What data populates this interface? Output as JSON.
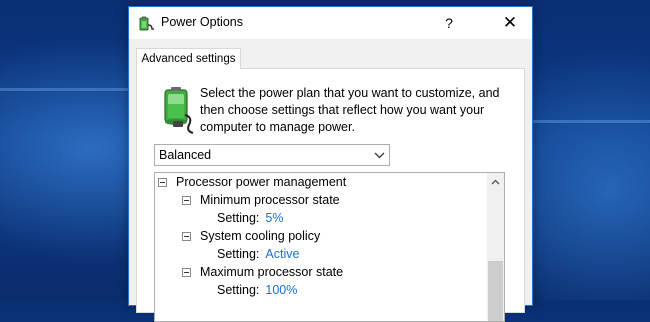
{
  "window": {
    "title": "Power Options",
    "help_label": "?",
    "close_label": "✕"
  },
  "tab": {
    "label": "Advanced settings"
  },
  "intro_text": "Select the power plan that you want to customize, and then choose settings that reflect how you want your computer to manage power.",
  "plan_select": {
    "value": "Balanced"
  },
  "tree": {
    "group": "Processor power management",
    "items": [
      {
        "label": "Minimum processor state",
        "setting_label": "Setting:",
        "setting_value": "5%"
      },
      {
        "label": "System cooling policy",
        "setting_label": "Setting:",
        "setting_value": "Active"
      },
      {
        "label": "Maximum processor state",
        "setting_label": "Setting:",
        "setting_value": "100%"
      }
    ]
  },
  "icons": {
    "app": "power-options-icon",
    "battery": "battery-plug-icon",
    "chevron": "chevron-down-icon",
    "scroll_up": "scroll-up-arrow-icon"
  },
  "colors": {
    "setting_value": "#1a6fd1",
    "dialog_border": "#2b6fd2",
    "desktop": "#0d3a86"
  }
}
